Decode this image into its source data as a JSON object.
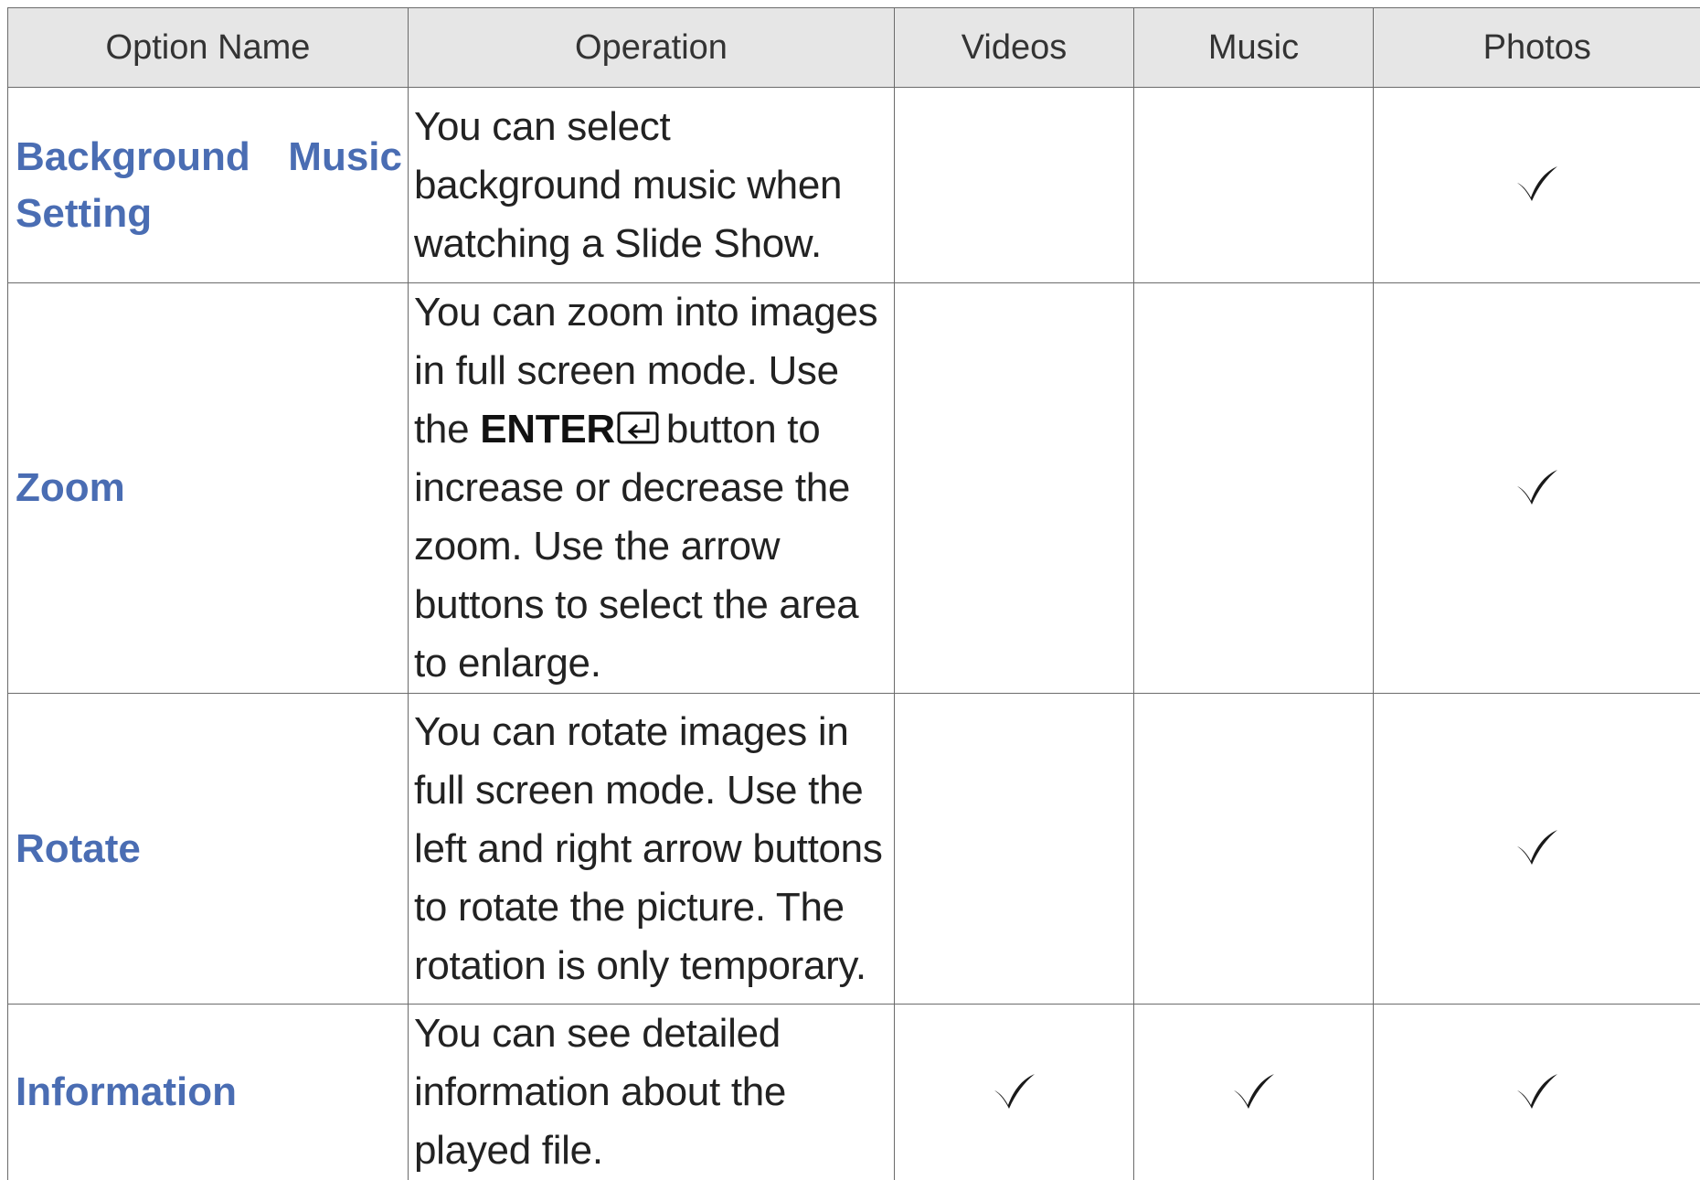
{
  "table": {
    "headers": {
      "option_name": "Option Name",
      "operation": "Operation",
      "videos": "Videos",
      "music": "Music",
      "photos": "Photos"
    },
    "rows": [
      {
        "name": "Background Music Setting",
        "operation": "You can select background music when watching a Slide Show.",
        "videos": false,
        "music": false,
        "photos": true
      },
      {
        "name": "Zoom",
        "operation_before": "You can zoom into images in full screen mode. Use the",
        "operation_keyword": "ENTER",
        "operation_icon": "enter-icon",
        "operation_after": "button to increase or decrease the zoom. Use the arrow buttons to select the area to enlarge.",
        "videos": false,
        "music": false,
        "photos": true
      },
      {
        "name": "Rotate",
        "operation": "You can rotate images in full screen mode. Use the left and right arrow buttons to rotate the picture. The rotation is only temporary.",
        "videos": false,
        "music": false,
        "photos": true
      },
      {
        "name": "Information",
        "operation": "You can see detailed information about the played file.",
        "videos": true,
        "music": true,
        "photos": true
      }
    ]
  },
  "colors": {
    "option_name": "#4a6db3",
    "header_background": "#e6e6e6",
    "border": "#6b6b6b"
  }
}
